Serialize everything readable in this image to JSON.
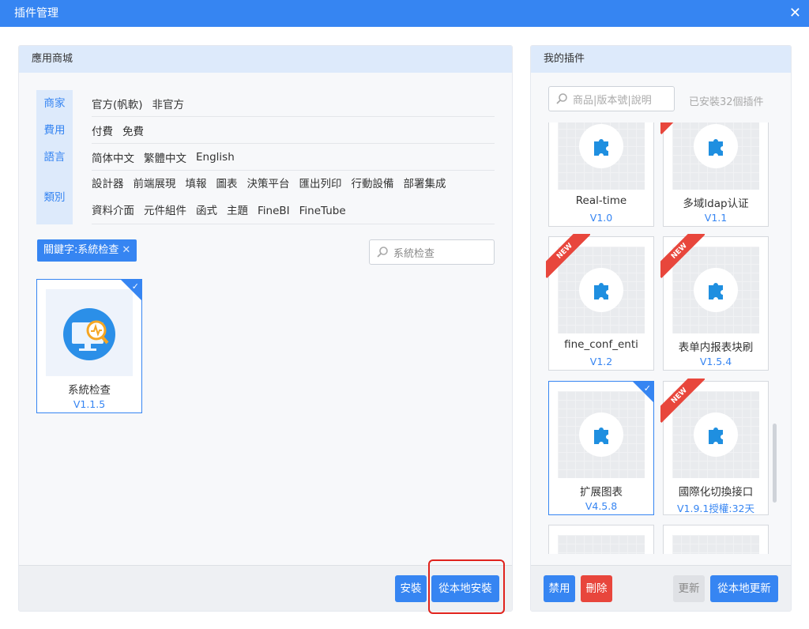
{
  "window": {
    "title": "插件管理",
    "close": "✕"
  },
  "store": {
    "header": "應用商城",
    "filters": [
      {
        "category": "商家",
        "options": [
          "官方(帆軟)",
          "非官方"
        ]
      },
      {
        "category": "費用",
        "options": [
          "付費",
          "免費"
        ]
      },
      {
        "category": "語言",
        "options": [
          "简体中文",
          "繁體中文",
          "English"
        ]
      },
      {
        "category": "類別",
        "options": [
          "設計器",
          "前端展現",
          "填報",
          "圖表",
          "決策平台",
          "匯出列印",
          "行動設備",
          "部署集成",
          "資料介面",
          "元件組件",
          "函式",
          "主題",
          "FineBI",
          "FineTube"
        ]
      }
    ],
    "keyword_tag": "關鍵字:系統检查",
    "keyword_close": "✕",
    "search_value": "系統检查",
    "result": {
      "name": "系統检查",
      "version": "V1.1.5",
      "selected": true
    },
    "buttons": {
      "install": "安裝",
      "install_local": "從本地安裝"
    }
  },
  "mine": {
    "header": "我的插件",
    "search_placeholder": "商品|版本號|說明",
    "installed_count": "已安裝32個插件",
    "plugins": [
      {
        "name": "Real-time",
        "version": "V1.0",
        "new": false,
        "selected": false
      },
      {
        "name": "多域ldap认证",
        "version": "V1.1",
        "new": true,
        "selected": false
      },
      {
        "name": "fine_conf_enti",
        "version": "V1.2",
        "new": true,
        "selected": false
      },
      {
        "name": "表单内报表块刷",
        "version": "V1.5.4",
        "new": true,
        "selected": false
      },
      {
        "name": "扩展图表",
        "version": "V4.5.8",
        "new": false,
        "selected": true
      },
      {
        "name": "國際化切換接口",
        "version": "V1.9.1授權:32天",
        "new": true,
        "selected": false
      },
      {
        "name": "",
        "version": "",
        "new": false,
        "selected": false
      },
      {
        "name": "",
        "version": "",
        "new": false,
        "selected": false
      }
    ],
    "new_label": "NEW",
    "buttons": {
      "disable": "禁用",
      "delete": "刪除",
      "update": "更新",
      "update_local": "從本地更新"
    }
  },
  "colors": {
    "accent": "#3685f2",
    "danger": "#e8463c",
    "highlight": "#e0231d"
  }
}
